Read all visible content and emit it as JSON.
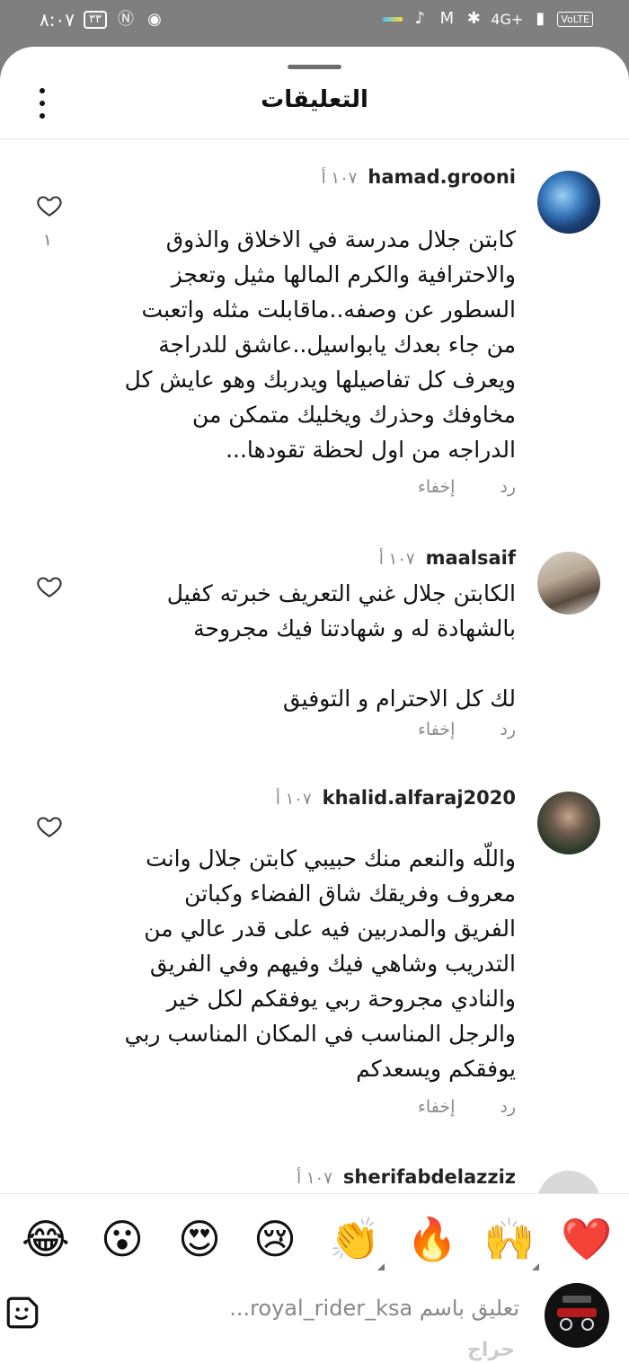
{
  "status_bar": {
    "time": "٨:٠٧",
    "battery": "٣٣",
    "volte": "VoLTE",
    "network": "4G+"
  },
  "header": {
    "title": "التعليقات"
  },
  "comments": [
    {
      "username": "hamad.grooni",
      "time": "١٠٧ أ",
      "text": "كابتن جلال مدرسة في الاخلاق والذوق والاحترافية والكرم المالها مثيل وتعجز السطور عن وصفه..ماقابلت مثله واتعبت من جاء بعدك يابواسيل..عاشق للدراجة ويعرف كل تفاصيلها ويدربك وهو عايش كل مخاوفك وحذرك ويخليك متمكن من الدراجه من اول لحظة تقودها...",
      "reply": "رد",
      "hide": "إخفاء",
      "likes": "١"
    },
    {
      "username": "maalsaif",
      "time": "١٠٧ أ",
      "text": "الكابتن جلال غني التعريف خبرته كفيل بالشهادة له و شهادتنا فيك مجروحة\n\nلك كل الاحترام و التوفيق",
      "reply": "رد",
      "hide": "إخفاء",
      "likes": ""
    },
    {
      "username": "khalid.alfaraj2020",
      "time": "١٠٧ أ",
      "text": "واللّه والنعم منك حبيبي كابتن جلال وانت معروف وفريقك شاق الفضاء وكباتن الفريق والمدربين فيه على قدر عالي من التدريب وشاهي فيك وفيهم وفي الفريق والنادي مجروحة ربي يوفقكم لكل خير والرجل المناسب في المكان المناسب ربي يوفقكم ويسعدكم",
      "reply": "رد",
      "hide": "إخفاء",
      "likes": ""
    },
    {
      "username": "sherifabdelazziz",
      "time": "١٠٧ أ"
    }
  ],
  "emoji_bar": [
    "❤️",
    "🙌",
    "🔥",
    "👏",
    "😢",
    "😍",
    "😮",
    "😂"
  ],
  "input": {
    "placeholder": "تعليق باسم royal_rider_ksa..."
  },
  "watermark": "حراج"
}
